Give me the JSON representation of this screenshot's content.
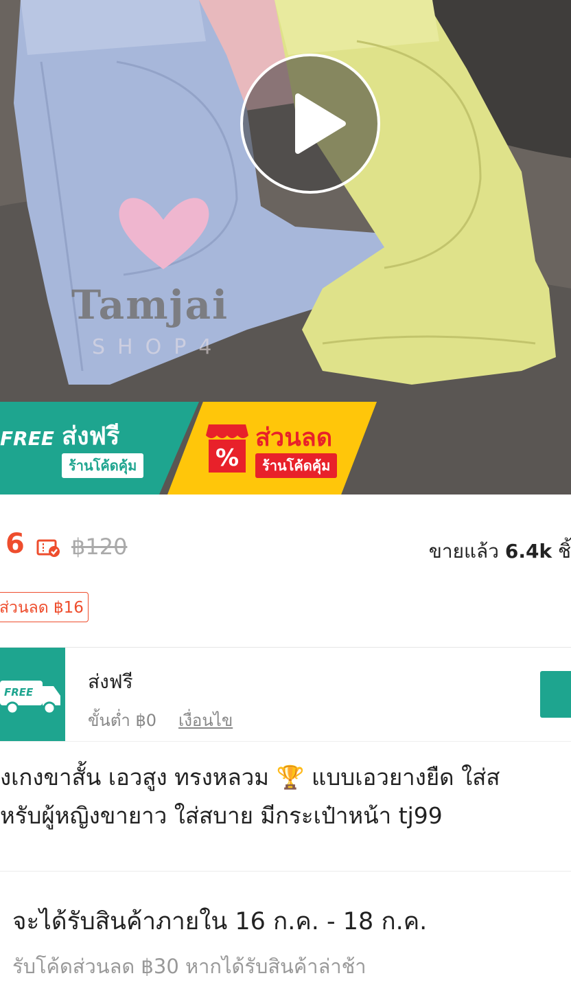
{
  "hero": {
    "watermark_brand": "Tamjai",
    "watermark_shop": "SHOP4",
    "free_banner": {
      "badge": "FREE",
      "title": "ส่งฟรี",
      "pill": "ร้านโค้ดคุ้ม",
      "color": "#1ea58f"
    },
    "sale_banner": {
      "icon": "percent-shop-icon",
      "title": "ส่วนลด",
      "pill": "ร้านโค้ดคุ้ม",
      "color": "#ffc60a"
    }
  },
  "price": {
    "current": "6",
    "original": "฿120",
    "sold_label": "ขายแล้ว",
    "sold_count": "6.4k",
    "sold_unit": "ชิ้",
    "accent": "#ee4d2d"
  },
  "discount_tag": "ส่วนลด ฿16",
  "shipping": {
    "badge": "FREE",
    "title": "ส่งฟรี",
    "minimum": "ขั้นต่ำ ฿0",
    "conditions_link": "เงื่อนไข"
  },
  "product_title": {
    "line1": "งเกงขาสั้น เอวสูง ทรงหลวม 🏆 แบบเอวยางยืด ใส่ส",
    "line2": "หรับผู้หญิงขายาว ใส่สบาย มีกระเป๋าหน้า tj99"
  },
  "delivery": {
    "estimate": "จะได้รับสินค้าภายใน 16 ก.ค. - 18 ก.ค.",
    "late_voucher": "รับโค้ดส่วนลด ฿30 หากได้รับสินค้าล่าช้า"
  }
}
